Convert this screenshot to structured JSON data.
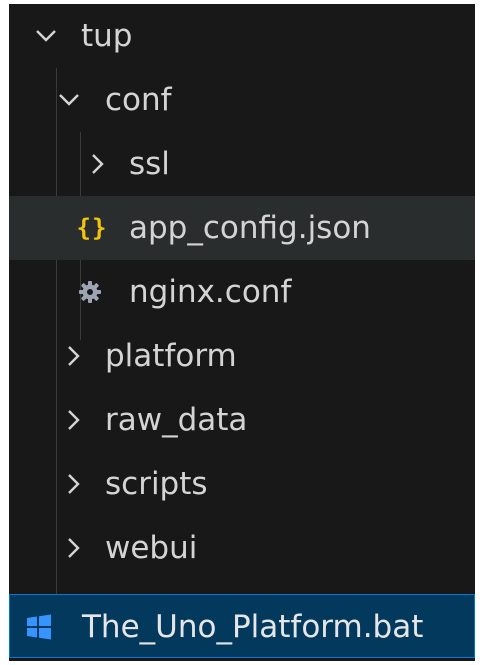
{
  "explorer": {
    "items": [
      {
        "label": "tup",
        "type": "folder",
        "expanded": true
      },
      {
        "label": "conf",
        "type": "folder",
        "expanded": true
      },
      {
        "label": "ssl",
        "type": "folder",
        "expanded": false
      },
      {
        "label": "app_config.json",
        "type": "file",
        "icon": "json-braces-icon",
        "state": "hover"
      },
      {
        "label": "nginx.conf",
        "type": "file",
        "icon": "gear-icon"
      },
      {
        "label": "platform",
        "type": "folder",
        "expanded": false
      },
      {
        "label": "raw_data",
        "type": "folder",
        "expanded": false
      },
      {
        "label": "scripts",
        "type": "folder",
        "expanded": false
      },
      {
        "label": "webui",
        "type": "folder",
        "expanded": false
      },
      {
        "label": "The_Uno_Platform.bat",
        "type": "file",
        "icon": "windows-icon",
        "state": "selected"
      }
    ],
    "json_icon_glyph": "{}"
  },
  "colors": {
    "background": "#181818",
    "text": "#d4d4d4",
    "hover": "#2a2d2e",
    "selected": "#04395e",
    "selected_border": "#0078d4",
    "json_icon": "#f1c40f",
    "gear_icon": "#9da5b4",
    "windows_icon": "#3794ff"
  }
}
